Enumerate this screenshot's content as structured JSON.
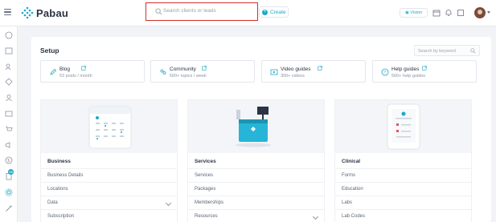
{
  "app": {
    "brand": "Pabau"
  },
  "header": {
    "search_placeholder": "Search clients or leads",
    "create_label": "Create",
    "vision_label": "Vision"
  },
  "colors": {
    "accent": "#1ea8c7",
    "highlight": "#d32f2f"
  },
  "sidebar": {
    "icons": [
      "dashboard-icon",
      "calendar-icon",
      "contacts-icon",
      "leads-icon",
      "user-icon",
      "inbox-icon",
      "cart-icon",
      "megaphone-icon",
      "finance-icon",
      "clipboard-icon",
      "settings-icon",
      "magic-icon"
    ],
    "badge": "16"
  },
  "setup": {
    "title": "Setup",
    "keyword_placeholder": "Search by keyword",
    "link_cards": [
      {
        "title": "Blog",
        "subtitle": "53 posts / month",
        "icon": "pen-icon"
      },
      {
        "title": "Community",
        "subtitle": "500+ topics / week",
        "icon": "community-icon"
      },
      {
        "title": "Video guides",
        "subtitle": "300+ videos",
        "icon": "video-icon"
      },
      {
        "title": "Help guides",
        "subtitle": "500+ help guides",
        "icon": "help-icon"
      }
    ],
    "columns": [
      {
        "heading": "Business",
        "items": [
          "Business Details",
          "Locations",
          "Data",
          "Subscription"
        ],
        "expandable": [
          false,
          false,
          true,
          false
        ]
      },
      {
        "heading": "Services",
        "items": [
          "Services",
          "Packages",
          "Memberships",
          "Resources"
        ],
        "expandable": [
          false,
          false,
          false,
          true
        ]
      },
      {
        "heading": "Clinical",
        "items": [
          "Forms",
          "Education",
          "Labs",
          "Lab Codes"
        ],
        "expandable": [
          false,
          false,
          false,
          false
        ]
      }
    ]
  }
}
